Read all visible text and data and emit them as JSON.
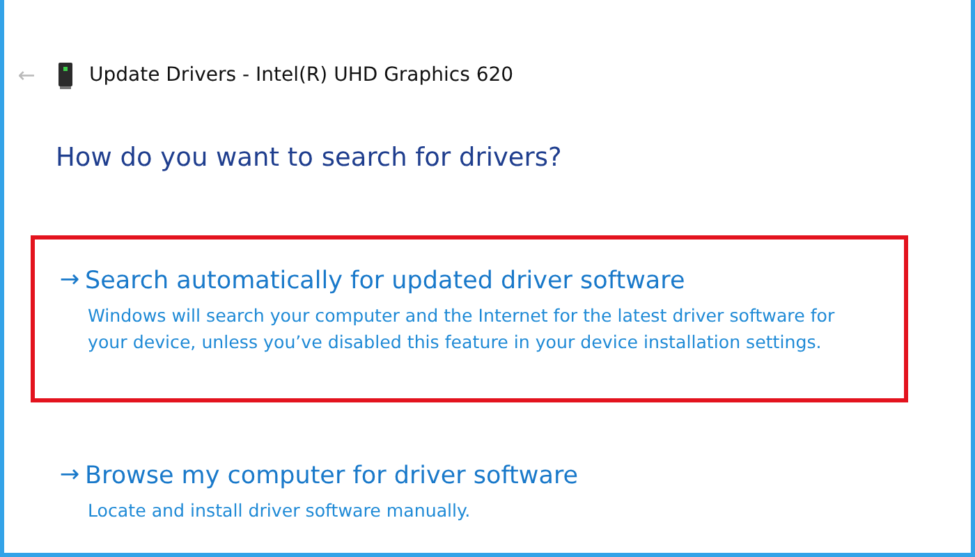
{
  "back_button": "←",
  "window": {
    "title": "Update Drivers - Intel(R) UHD Graphics 620"
  },
  "heading": "How do you want to search for drivers?",
  "options": [
    {
      "arrow": "→",
      "title": "Search automatically for updated driver software",
      "description": "Windows will search your computer and the Internet for the latest driver software for your device, unless you’ve disabled this feature in your device installation settings.",
      "highlighted": true
    },
    {
      "arrow": "→",
      "title": "Browse my computer for driver software",
      "description": "Locate and install driver software manually.",
      "highlighted": false
    }
  ]
}
